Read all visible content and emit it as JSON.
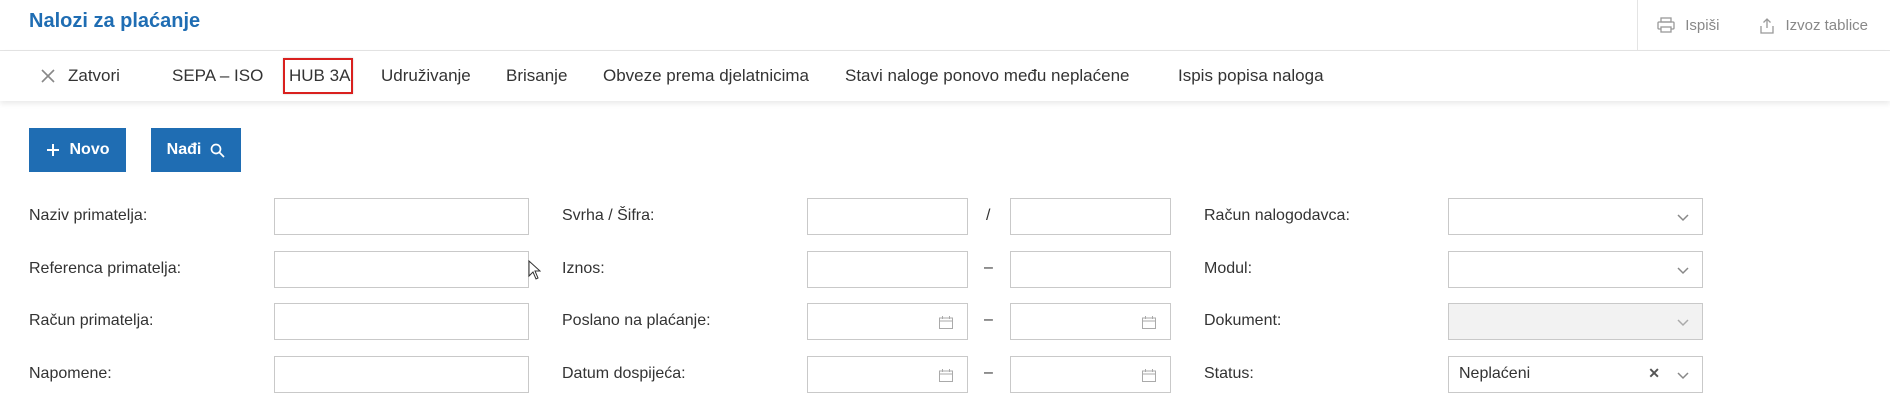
{
  "header": {
    "title": "Nalozi za plaćanje",
    "print_label": "Ispiši",
    "export_label": "Izvoz tablice"
  },
  "toolbar": {
    "close_label": "Zatvori",
    "items": [
      "SEPA – ISO",
      "HUB 3A",
      "Udruživanje",
      "Brisanje",
      "Obveze prema djelatnicima",
      "Stavi naloge ponovo među neplaćene",
      "Ispis popisa naloga"
    ]
  },
  "actions": {
    "new_label": "Novo",
    "find_label": "Nađi"
  },
  "filters": {
    "col1": {
      "recipient_name": "Naziv primatelja:",
      "recipient_reference": "Referenca primatelja:",
      "recipient_account": "Račun primatelja:",
      "notes": "Napomene:"
    },
    "col2": {
      "purpose_code": "Svrha / Šifra:",
      "purpose_sep": "/",
      "amount": "Iznos:",
      "sent_for_payment": "Poslano na plaćanje:",
      "due_date": "Datum dospijeća:",
      "range_sep": "–"
    },
    "col3": {
      "payer_account": "Račun nalogodavca:",
      "module": "Modul:",
      "document": "Dokument:",
      "status": "Status:",
      "status_value": "Neplaćeni"
    }
  },
  "colors": {
    "brand_blue": "#1f6db3",
    "highlight_red": "#d9201e"
  },
  "icons": [
    "printer-icon",
    "export-icon",
    "close-icon",
    "plus-icon",
    "search-icon",
    "calendar-icon",
    "chevron-down-icon",
    "clear-icon",
    "mouse-cursor-icon"
  ]
}
